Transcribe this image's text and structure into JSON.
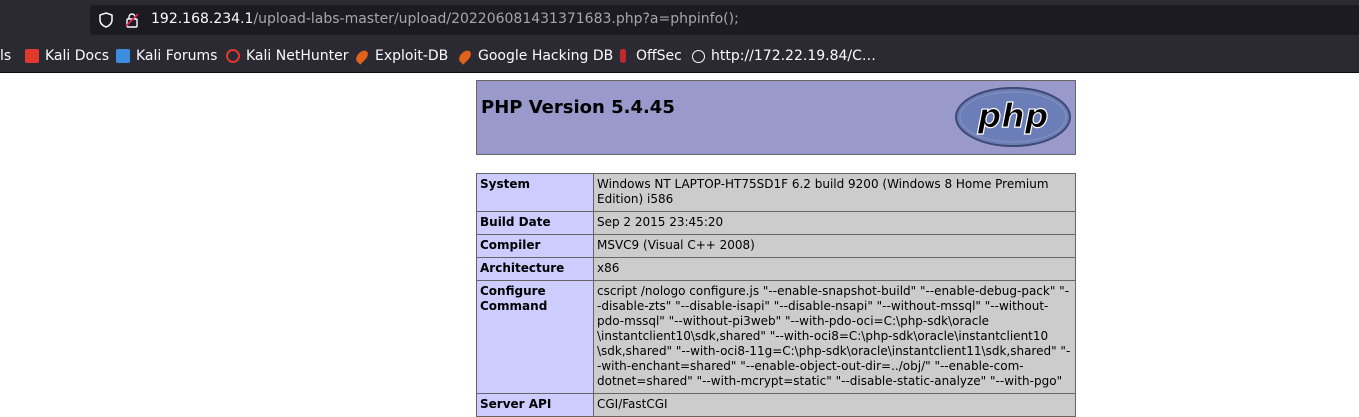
{
  "browser": {
    "url_host": "192.168.234.1",
    "url_path": "/upload-labs-master/upload/202206081431371683.php?a=phpinfo();",
    "bookmarks": [
      {
        "label": "ls",
        "icon": "none"
      },
      {
        "label": "Kali Docs",
        "icon": "kali-docs-icon"
      },
      {
        "label": "Kali Forums",
        "icon": "kali-forums-icon"
      },
      {
        "label": "Kali NetHunter",
        "icon": "kali-nethunter-icon"
      },
      {
        "label": "Exploit-DB",
        "icon": "exploit-db-icon"
      },
      {
        "label": "Google Hacking DB",
        "icon": "exploit-db-icon"
      },
      {
        "label": "OffSec",
        "icon": "offsec-icon"
      },
      {
        "label": "http://172.22.19.84/C…",
        "icon": "globe-icon"
      }
    ]
  },
  "phpinfo": {
    "title": "PHP Version 5.4.45",
    "logo_text": "php",
    "rows": [
      {
        "key": "System",
        "value": "Windows NT LAPTOP-HT75SD1F 6.2 build 9200 (Windows 8 Home Premium Edition) i586"
      },
      {
        "key": "Build Date",
        "value": "Sep 2 2015 23:45:20"
      },
      {
        "key": "Compiler",
        "value": "MSVC9 (Visual C++ 2008)"
      },
      {
        "key": "Architecture",
        "value": "x86"
      },
      {
        "key": "Configure Command",
        "value": "cscript /nologo configure.js \"--enable-snapshot-build\" \"--enable-debug-pack\" \"--disable-zts\" \"--disable-isapi\" \"--disable-nsapi\" \"--without-mssql\" \"--without-pdo-mssql\" \"--without-pi3web\" \"--with-pdo-oci=C:\\php-sdk\\oracle \\instantclient10\\sdk,shared\" \"--with-oci8=C:\\php-sdk\\oracle\\instantclient10 \\sdk,shared\" \"--with-oci8-11g=C:\\php-sdk\\oracle\\instantclient11\\sdk,shared\" \"--with-enchant=shared\" \"--enable-object-out-dir=../obj/\" \"--enable-com-dotnet=shared\" \"--with-mcrypt=static\" \"--disable-static-analyze\" \"--with-pgo\""
      },
      {
        "key": "Server API",
        "value": "CGI/FastCGI"
      }
    ]
  }
}
